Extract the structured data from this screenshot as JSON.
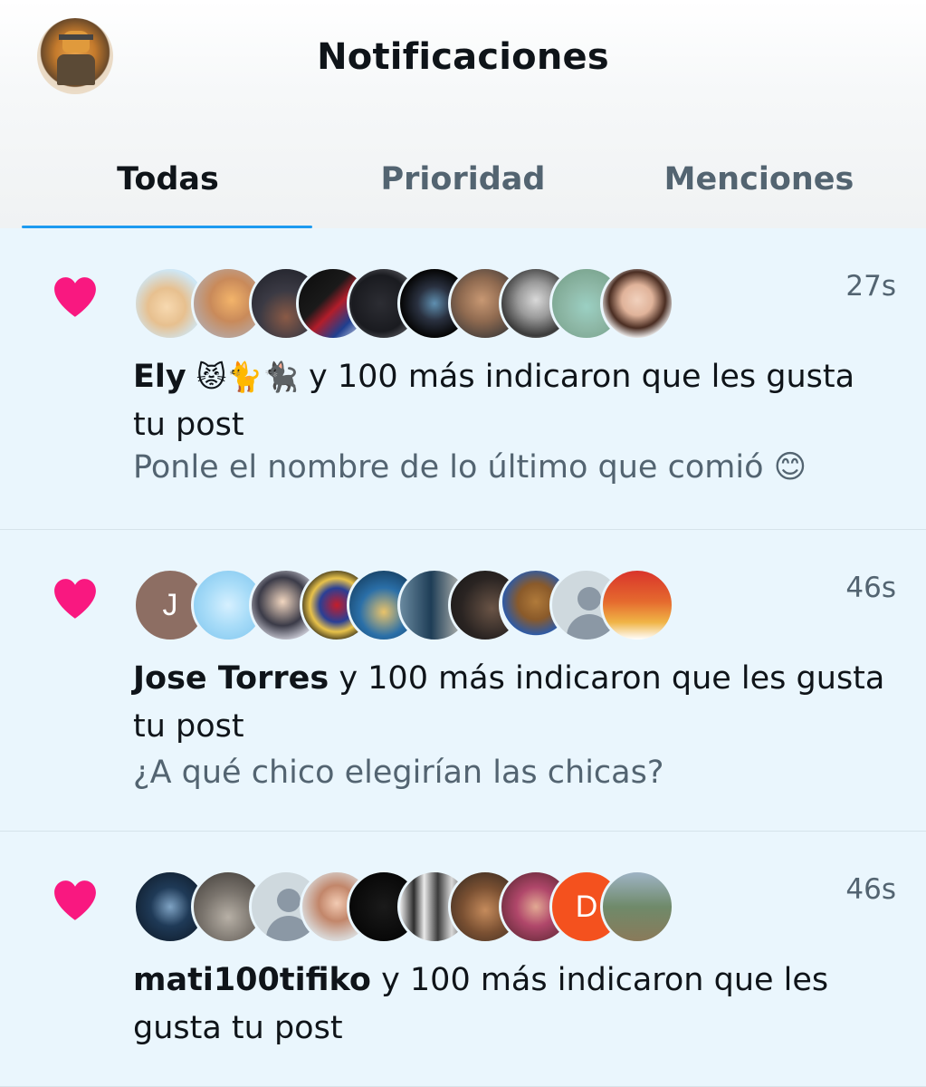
{
  "header": {
    "title": "Notificaciones",
    "tabs": [
      {
        "label": "Todas",
        "active": true
      },
      {
        "label": "Prioridad",
        "active": false
      },
      {
        "label": "Menciones",
        "active": false
      }
    ],
    "accent": "#1d9bf0"
  },
  "notifications": [
    {
      "user": "Ely",
      "user_emoji": "😾🐈🐈‍⬛",
      "action": " y 100 más indicaron que les gusta tu post",
      "post_text": "Ponle el nombre de lo último que comió 😊",
      "time": "27s",
      "icon": "heart-icon"
    },
    {
      "user": "Jose Torres",
      "user_emoji": "",
      "action": " y 100 más indicaron que les gusta tu post",
      "post_text": "¿A qué chico elegirían las chicas?",
      "time": "46s",
      "icon": "heart-icon",
      "first_avatar_letter": "J"
    },
    {
      "user": "mati100tifiko",
      "user_emoji": "",
      "action": " y 100 más indicaron que les gusta tu post",
      "post_text": "",
      "time": "46s",
      "icon": "heart-icon",
      "avatar_letter_9": "D"
    }
  ],
  "colors": {
    "heart": "#f91880",
    "row_bg": "#eaf6fd",
    "muted": "#536471"
  }
}
